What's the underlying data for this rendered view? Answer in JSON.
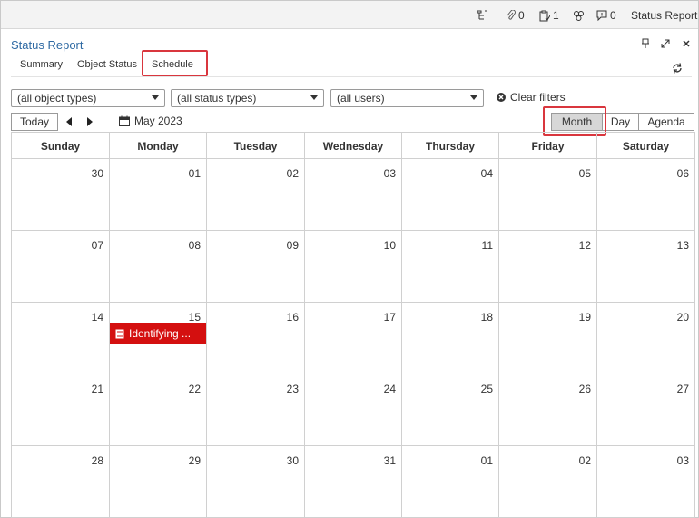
{
  "topbar": {
    "attachments_count": "0",
    "tasks_count": "1",
    "comments_count": "0",
    "report_label": "Status Report"
  },
  "panel": {
    "title": "Status Report"
  },
  "tabs": [
    {
      "label": "Summary"
    },
    {
      "label": "Object Status"
    },
    {
      "label": "Schedule",
      "active": true
    }
  ],
  "filters": {
    "object_types": "(all object types)",
    "status_types": "(all status types)",
    "users": "(all users)",
    "clear_label": "Clear filters"
  },
  "toolbar": {
    "today_label": "Today",
    "current_month": "May 2023",
    "views": [
      "Month",
      "Day",
      "Agenda"
    ],
    "active_view": "Month"
  },
  "calendar": {
    "days_of_week": [
      "Sunday",
      "Monday",
      "Tuesday",
      "Wednesday",
      "Thursday",
      "Friday",
      "Saturday"
    ],
    "weeks": [
      [
        "30",
        "01",
        "02",
        "03",
        "04",
        "05",
        "06"
      ],
      [
        "07",
        "08",
        "09",
        "10",
        "11",
        "12",
        "13"
      ],
      [
        "14",
        "15",
        "16",
        "17",
        "18",
        "19",
        "20"
      ],
      [
        "21",
        "22",
        "23",
        "24",
        "25",
        "26",
        "27"
      ],
      [
        "28",
        "29",
        "30",
        "31",
        "01",
        "02",
        "03"
      ]
    ],
    "event": {
      "label": "Identifying ...",
      "date": "15",
      "color": "#d40f0f"
    }
  },
  "colors": {
    "accent_highlight": "#d9363e",
    "title_blue": "#2f6aa3"
  }
}
